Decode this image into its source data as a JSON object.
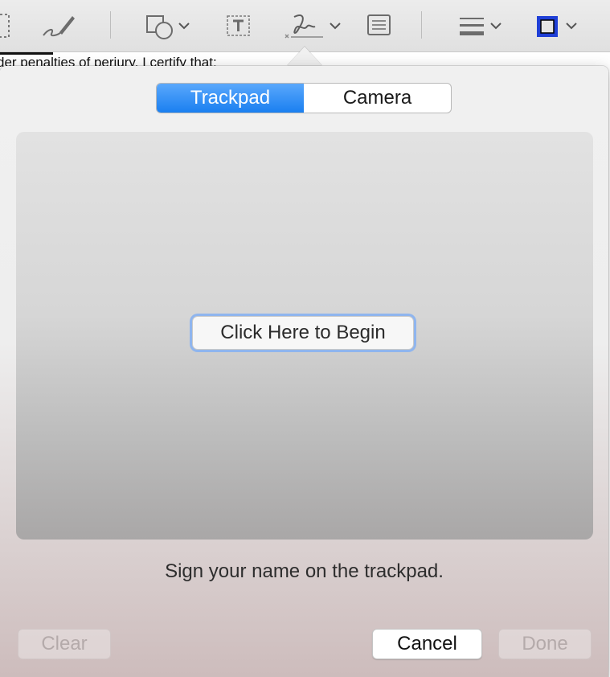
{
  "toolbar": {
    "tools": [
      {
        "icon": "selection-icon"
      },
      {
        "icon": "sketch-pen-icon"
      },
      {
        "icon": "shapes-icon",
        "has_menu": true
      },
      {
        "icon": "text-box-icon"
      },
      {
        "icon": "signature-icon",
        "has_menu": true
      },
      {
        "icon": "note-icon"
      },
      {
        "icon": "line-style-icon",
        "has_menu": true
      },
      {
        "icon": "border-color-icon",
        "has_menu": true,
        "color": "#1f3fd6"
      }
    ]
  },
  "document": {
    "visible_text": "der penalties of perjury, I certify that:"
  },
  "signature_panel": {
    "tabs": [
      {
        "label": "Trackpad",
        "active": true
      },
      {
        "label": "Camera",
        "active": false
      }
    ],
    "begin_button_label": "Click Here to Begin",
    "instruction": "Sign your name on the trackpad.",
    "buttons": {
      "clear": {
        "label": "Clear",
        "enabled": false
      },
      "cancel": {
        "label": "Cancel",
        "enabled": true
      },
      "done": {
        "label": "Done",
        "enabled": false
      }
    }
  },
  "colors": {
    "accent": "#1a7ff0",
    "focus_ring": "#8fb5ee"
  }
}
